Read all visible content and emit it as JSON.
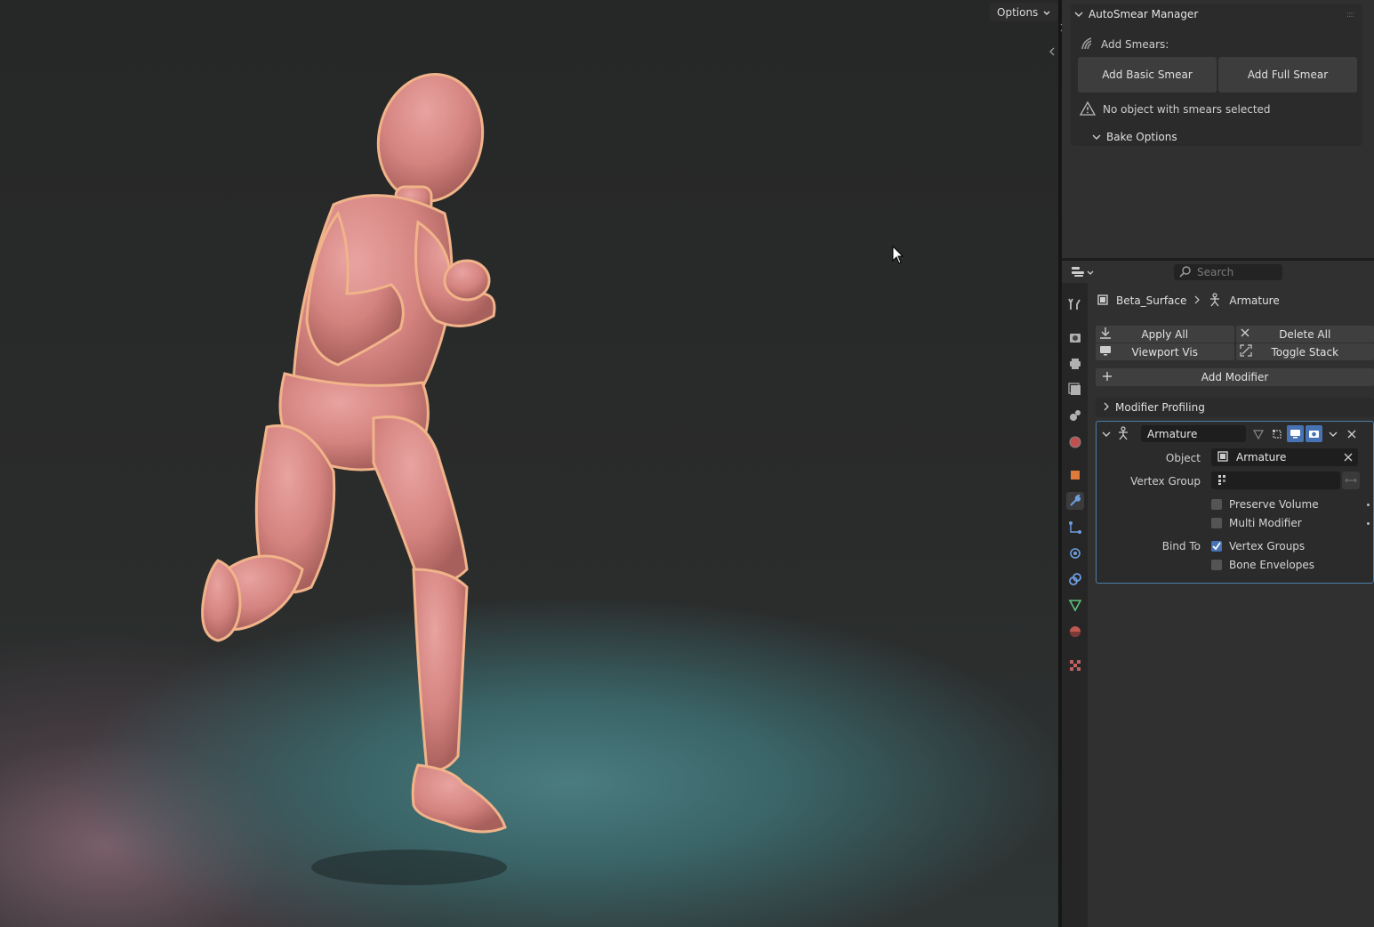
{
  "viewport": {
    "options_label": "Options"
  },
  "autosmear": {
    "title": "AutoSmear Manager",
    "add_smears_label": "Add Smears:",
    "add_basic_label": "Add Basic Smear",
    "add_full_label": "Add Full Smear",
    "warning": "No object with smears selected",
    "bake_options_label": "Bake Options"
  },
  "properties": {
    "search_placeholder": "Search",
    "breadcrumb": {
      "object": "Beta_Surface",
      "modifier": "Armature"
    },
    "buttons": {
      "apply_all": "Apply All",
      "delete_all": "Delete All",
      "viewport_vis": "Viewport Vis",
      "toggle_stack": "Toggle Stack",
      "add_modifier": "Add Modifier"
    },
    "modifier_profiling": "Modifier Profiling",
    "modifier": {
      "name": "Armature",
      "object_label": "Object",
      "object_value": "Armature",
      "vertex_group_label": "Vertex Group",
      "vertex_group_value": "",
      "preserve_volume": {
        "label": "Preserve Volume",
        "checked": false
      },
      "multi_modifier": {
        "label": "Multi Modifier",
        "checked": false
      },
      "bind_to_label": "Bind To",
      "vertex_groups": {
        "label": "Vertex Groups",
        "checked": true
      },
      "bone_envelopes": {
        "label": "Bone Envelopes",
        "checked": false
      }
    }
  },
  "colors": {
    "accent": "#4772b3",
    "panel_bg": "#303030",
    "figure": "#d98c8a",
    "floor": "#4a7c80"
  }
}
